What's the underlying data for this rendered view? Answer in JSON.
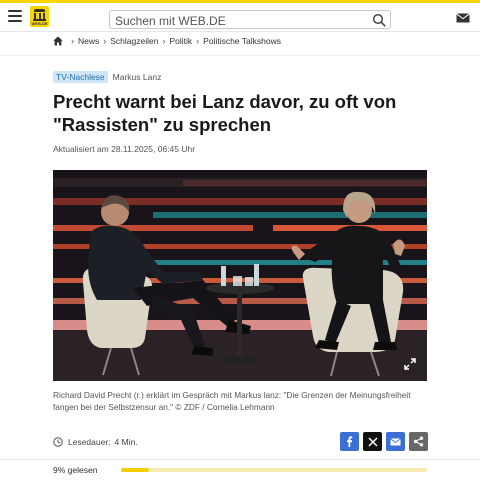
{
  "header": {
    "menu_icon": "hamburger-icon",
    "logo_text": "WEB.DE",
    "search_placeholder": "Suchen mit WEB.DE",
    "search_icon": "search-icon",
    "mail_icon": "mail-icon",
    "brand_color": "#f8d500"
  },
  "breadcrumb": {
    "home_icon": "home-icon",
    "items": [
      "News",
      "Schlagzeilen",
      "Politik",
      "Politische Talkshows"
    ]
  },
  "article": {
    "tag": "TV-Nachlese",
    "author": "Markus Lanz",
    "headline": "Precht warnt bei Lanz davor, zu oft von \"Rassisten\" zu sprechen",
    "updated": "Aktualisiert am 28.11.2025, 06:45 Uhr",
    "caption": "Richard David Precht (r.) erklärt im Gespräch mit Markus lanz: \"Die Grenzen der Meinungsfreiheit fangen bei der Selbstzensur an.\" © ZDF / Cornelia Lehmann",
    "read_label": "Lesedauer:",
    "read_value": "4 Min."
  },
  "share": {
    "facebook_icon": "facebook-icon",
    "x_icon": "x-icon",
    "mail_icon": "mail-share-icon",
    "more_icon": "share-icon"
  },
  "progress": {
    "label": "9% gelesen",
    "fraction": 0.09
  }
}
